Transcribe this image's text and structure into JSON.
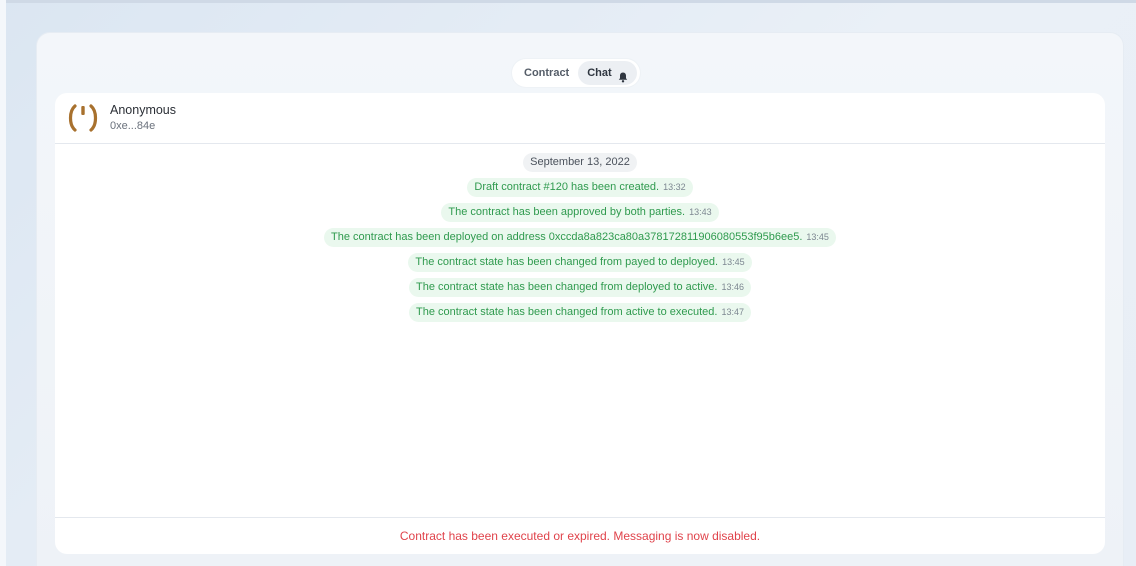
{
  "tabs": [
    {
      "label": "Contract",
      "active": false
    },
    {
      "label": "Chat",
      "active": true
    }
  ],
  "icons": {
    "tab_chat": "bell-icon",
    "avatar": "avatar-icon"
  },
  "colors": {
    "message_text": "#2f9a4e",
    "message_bg": "#eaf8ee",
    "warning_text": "#e0434b",
    "avatar": "#a8712e"
  },
  "header": {
    "name": "Anonymous",
    "address": "0xe...84e"
  },
  "date_label": "September 13, 2022",
  "messages": [
    {
      "text": "Draft contract #120 has been created.",
      "time": "13:32"
    },
    {
      "text": "The contract has been approved by both parties.",
      "time": "13:43"
    },
    {
      "text": "The contract has been deployed on address 0xccda8a823ca80a378172811906080553f95b6ee5.",
      "time": "13:45"
    },
    {
      "text": "The contract state has been changed from payed to deployed.",
      "time": "13:45"
    },
    {
      "text": "The contract state has been changed from deployed to active.",
      "time": "13:46"
    },
    {
      "text": "The contract state has been changed from active to executed.",
      "time": "13:47"
    }
  ],
  "footer": {
    "disabled_notice": "Contract has been executed or expired. Messaging is now disabled."
  }
}
